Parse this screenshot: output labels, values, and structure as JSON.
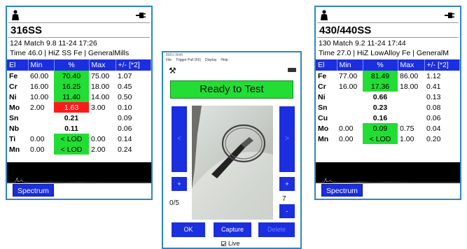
{
  "colors": {
    "header_blue": "#1b2ee0",
    "pass_green": "#22dd33",
    "fail_red": "#ff1a1a",
    "frame_blue": "#2e86c1"
  },
  "icons": {
    "person": "person-icon",
    "plug": "power-plug-icon",
    "tools": "tools-icon",
    "battery": "battery-icon"
  },
  "left_panel": {
    "alloy": "316SS",
    "info_line1": "124  Match   9.8 11-24 17:26",
    "info_line2": "Time 46.0 | HiZ SS Fe | GeneralMills",
    "headers": [
      "El",
      "Min",
      "%",
      "Max",
      "+/- [*2]"
    ],
    "rows": [
      {
        "el": "Fe",
        "min": "60.00",
        "pct": "70.40",
        "max": "75.00",
        "err": "1.07",
        "status": "green"
      },
      {
        "el": "Cr",
        "min": "16.00",
        "pct": "16.25",
        "max": "18.00",
        "err": "0.45",
        "status": "green"
      },
      {
        "el": "Ni",
        "min": "10.00",
        "pct": "11.40",
        "max": "14.00",
        "err": "0.50",
        "status": "green"
      },
      {
        "el": "Mo",
        "min": "2.00",
        "pct": "1.63",
        "max": "3.00",
        "err": "0.10",
        "status": "red"
      },
      {
        "el": "Sn",
        "min": "",
        "pct": "0.21",
        "max": "",
        "err": "0.09",
        "status": "none"
      },
      {
        "el": "Nb",
        "min": "",
        "pct": "0.11",
        "max": "",
        "err": "0.06",
        "status": "none"
      },
      {
        "el": "Ti",
        "min": "0.00",
        "pct": "< LOD",
        "max": "0.00",
        "err": "0.14",
        "status": "green"
      },
      {
        "el": "Mn",
        "min": "0.00",
        "pct": "< LOD",
        "max": "2.00",
        "err": "0.24",
        "status": "green"
      }
    ],
    "spectrum_button": "Spectrum"
  },
  "right_panel": {
    "alloy": "430/440SS",
    "info_line1": "130  Match   9.2 11-24 17:44",
    "info_line2": "Time 27.0 | HiZ LowAlloy Fe | GeneralM",
    "headers": [
      "El",
      "Min",
      "%",
      "Max",
      "+/- [*2]"
    ],
    "rows": [
      {
        "el": "Fe",
        "min": "77.00",
        "pct": "81.49",
        "max": "86.00",
        "err": "1.12",
        "status": "green"
      },
      {
        "el": "Cr",
        "min": "16.00",
        "pct": "17.36",
        "max": "18.00",
        "err": "0.41",
        "status": "green"
      },
      {
        "el": "Ni",
        "min": "",
        "pct": "0.66",
        "max": "",
        "err": "0.13",
        "status": "none"
      },
      {
        "el": "Sn",
        "min": "",
        "pct": "0.23",
        "max": "",
        "err": "0.08",
        "status": "none"
      },
      {
        "el": "Cu",
        "min": "",
        "pct": "0.16",
        "max": "",
        "err": "0.06",
        "status": "none"
      },
      {
        "el": "Mo",
        "min": "0.00",
        "pct": "0.09",
        "max": "0.75",
        "err": "0.04",
        "status": "green"
      },
      {
        "el": "Mn",
        "min": "0.00",
        "pct": "< LOD",
        "max": "1.00",
        "err": "0.20",
        "status": "green"
      }
    ],
    "spectrum_button": "Spectrum"
  },
  "center_window": {
    "title": "800V-3645",
    "menu": [
      "File",
      "Trigger Pull (F6)",
      "Display",
      "Help"
    ],
    "status": "Ready to Test",
    "nav_prev": "<",
    "nav_next": ">",
    "plus_left": "+",
    "plus_right": "+",
    "minus": "-",
    "count_left": "0/5",
    "count_right": "7",
    "ok_label": "OK",
    "capture_label": "Capture",
    "delete_label": "Delete",
    "live_label": "Live"
  }
}
